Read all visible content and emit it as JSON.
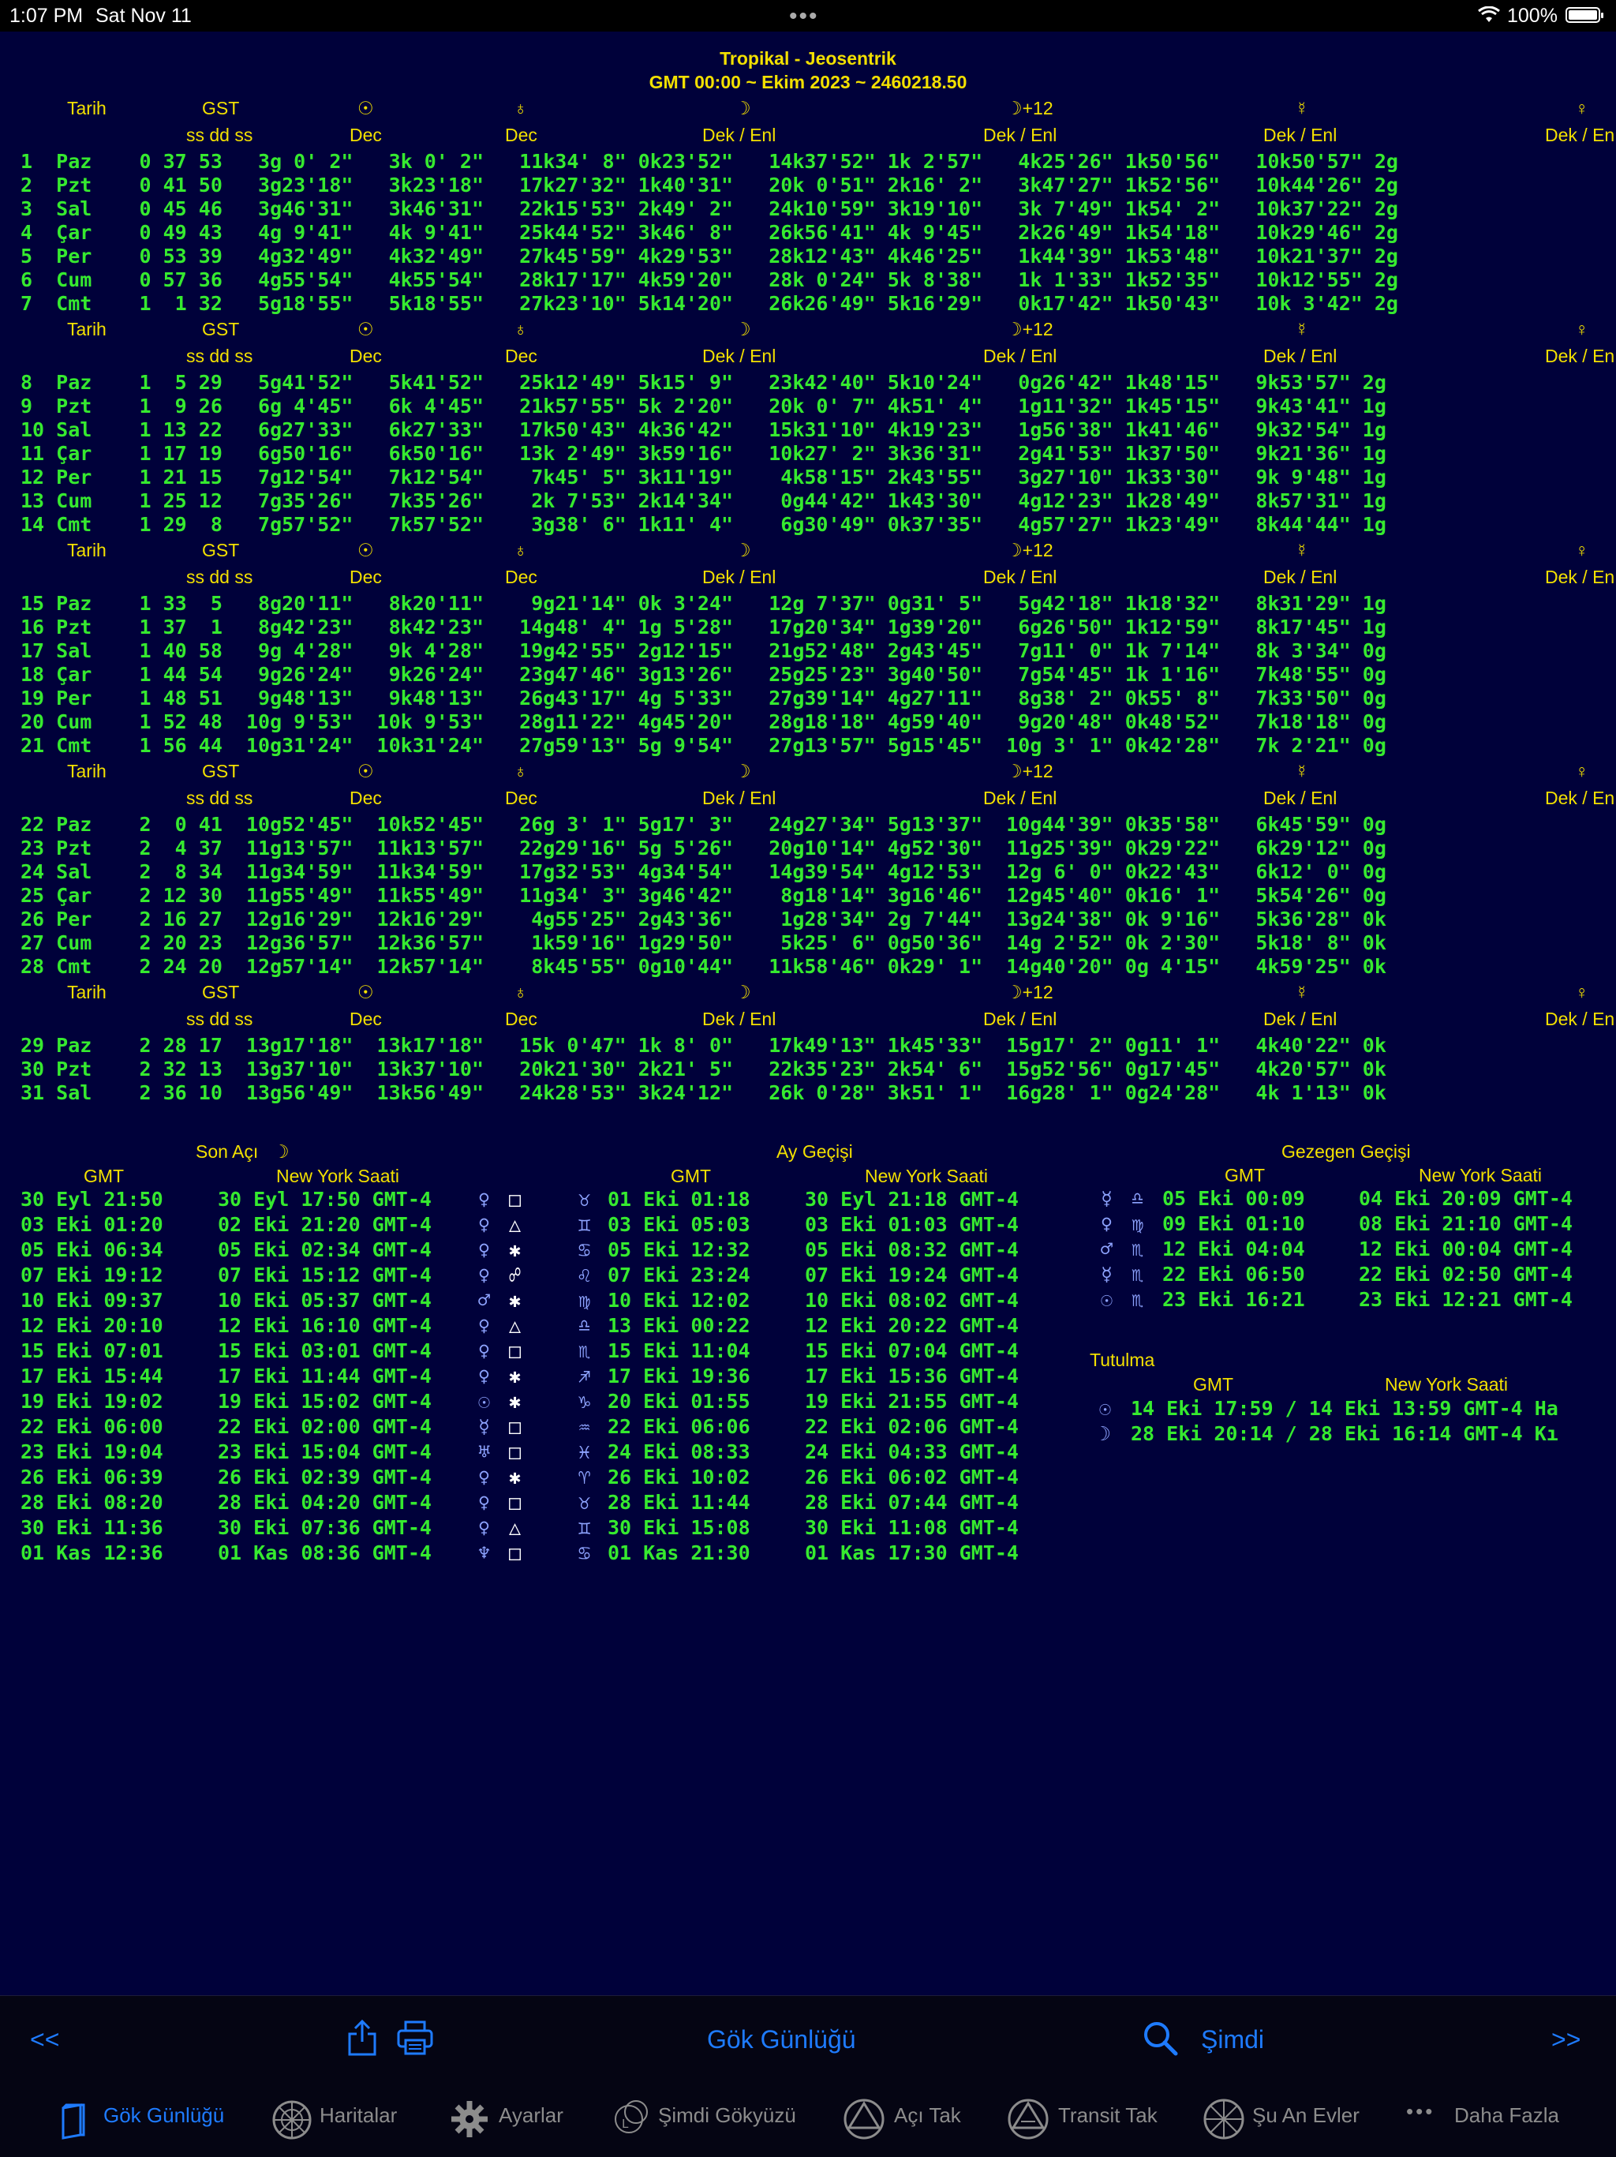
{
  "status_bar": {
    "time": "1:07 PM",
    "date": "Sat Nov 11",
    "battery": "100%"
  },
  "header": {
    "title": "Tropikal - Jeosentrik",
    "subtitle": "GMT 00:00 ~ Ekim 2023 ~ 2460218.50"
  },
  "ephemeris": {
    "col_headers": {
      "tarih": "Tarih",
      "gst": "GST",
      "sun": "☉",
      "earth": "♁",
      "moon": "☽",
      "moon12": "☽+12",
      "mercury": "☿",
      "venus": "♀"
    },
    "sub_headers": {
      "gst": "ss dd ss",
      "sun": "Dec",
      "earth": "Dec",
      "moon": "Dek / Enl",
      "moon12": "Dek / Enl",
      "mercury": "Dek / Enl",
      "venus": "Dek / En"
    },
    "rows": [
      "1  Paz    0 37 53   3g 0' 2\"   3k 0' 2\"   11k34' 8\" 0k23'52\"   14k37'52\" 1k 2'57\"   4k25'26\" 1k50'56\"   10k50'57\" 2g",
      "2  Pzt    0 41 50   3g23'18\"   3k23'18\"   17k27'32\" 1k40'31\"   20k 0'51\" 2k16' 2\"   3k47'27\" 1k52'56\"   10k44'26\" 2g",
      "3  Sal    0 45 46   3g46'31\"   3k46'31\"   22k15'53\" 2k49' 2\"   24k10'59\" 3k19'10\"   3k 7'49\" 1k54' 2\"   10k37'22\" 2g",
      "4  Çar    0 49 43   4g 9'41\"   4k 9'41\"   25k44'52\" 3k46' 8\"   26k56'41\" 4k 9'45\"   2k26'49\" 1k54'18\"   10k29'46\" 2g",
      "5  Per    0 53 39   4g32'49\"   4k32'49\"   27k45'59\" 4k29'53\"   28k12'43\" 4k46'25\"   1k44'39\" 1k53'48\"   10k21'37\" 2g",
      "6  Cum    0 57 36   4g55'54\"   4k55'54\"   28k17'17\" 4k59'20\"   28k 0'24\" 5k 8'38\"   1k 1'33\" 1k52'35\"   10k12'55\" 2g",
      "7  Cmt    1  1 32   5g18'55\"   5k18'55\"   27k23'10\" 5k14'20\"   26k26'49\" 5k16'29\"   0k17'42\" 1k50'43\"   10k 3'42\" 2g",
      "8  Paz    1  5 29   5g41'52\"   5k41'52\"   25k12'49\" 5k15' 9\"   23k42'40\" 5k10'24\"   0g26'42\" 1k48'15\"   9k53'57\" 2g",
      "9  Pzt    1  9 26   6g 4'45\"   6k 4'45\"   21k57'55\" 5k 2'20\"   20k 0' 7\" 4k51' 4\"   1g11'32\" 1k45'15\"   9k43'41\" 1g",
      "10 Sal    1 13 22   6g27'33\"   6k27'33\"   17k50'43\" 4k36'42\"   15k31'10\" 4k19'23\"   1g56'38\" 1k41'46\"   9k32'54\" 1g",
      "11 Çar    1 17 19   6g50'16\"   6k50'16\"   13k 2'49\" 3k59'16\"   10k27' 2\" 3k36'31\"   2g41'53\" 1k37'50\"   9k21'36\" 1g",
      "12 Per    1 21 15   7g12'54\"   7k12'54\"    7k45' 5\" 3k11'19\"    4k58'15\" 2k43'55\"   3g27'10\" 1k33'30\"   9k 9'48\" 1g",
      "13 Cum    1 25 12   7g35'26\"   7k35'26\"    2k 7'53\" 2k14'34\"    0g44'42\" 1k43'30\"   4g12'23\" 1k28'49\"   8k57'31\" 1g",
      "14 Cmt    1 29  8   7g57'52\"   7k57'52\"    3g38' 6\" 1k11' 4\"    6g30'49\" 0k37'35\"   4g57'27\" 1k23'49\"   8k44'44\" 1g",
      "15 Paz    1 33  5   8g20'11\"   8k20'11\"    9g21'14\" 0k 3'24\"   12g 7'37\" 0g31' 5\"   5g42'18\" 1k18'32\"   8k31'29\" 1g",
      "16 Pzt    1 37  1   8g42'23\"   8k42'23\"   14g48' 4\" 1g 5'28\"   17g20'34\" 1g39'20\"   6g26'50\" 1k12'59\"   8k17'45\" 1g",
      "17 Sal    1 40 58   9g 4'28\"   9k 4'28\"   19g42'55\" 2g12'15\"   21g52'48\" 2g43'45\"   7g11' 0\" 1k 7'14\"   8k 3'34\" 0g",
      "18 Çar    1 44 54   9g26'24\"   9k26'24\"   23g47'46\" 3g13'26\"   25g25'23\" 3g40'50\"   7g54'45\" 1k 1'16\"   7k48'55\" 0g",
      "19 Per    1 48 51   9g48'13\"   9k48'13\"   26g43'17\" 4g 5'33\"   27g39'14\" 4g27'11\"   8g38' 2\" 0k55' 8\"   7k33'50\" 0g",
      "20 Cum    1 52 48  10g 9'53\"  10k 9'53\"   28g11'22\" 4g45'20\"   28g18'18\" 4g59'40\"   9g20'48\" 0k48'52\"   7k18'18\" 0g",
      "21 Cmt    1 56 44  10g31'24\"  10k31'24\"   27g59'13\" 5g 9'54\"   27g13'57\" 5g15'45\"  10g 3' 1\" 0k42'28\"   7k 2'21\" 0g",
      "22 Paz    2  0 41  10g52'45\"  10k52'45\"   26g 3' 1\" 5g17' 3\"   24g27'34\" 5g13'37\"  10g44'39\" 0k35'58\"   6k45'59\" 0g",
      "23 Pzt    2  4 37  11g13'57\"  11k13'57\"   22g29'16\" 5g 5'26\"   20g10'14\" 4g52'30\"  11g25'39\" 0k29'22\"   6k29'12\" 0g",
      "24 Sal    2  8 34  11g34'59\"  11k34'59\"   17g32'53\" 4g34'54\"   14g39'54\" 4g12'53\"  12g 6' 0\" 0k22'43\"   6k12' 0\" 0g",
      "25 Çar    2 12 30  11g55'49\"  11k55'49\"   11g34' 3\" 3g46'42\"    8g18'14\" 3g16'46\"  12g45'40\" 0k16' 1\"   5k54'26\" 0g",
      "26 Per    2 16 27  12g16'29\"  12k16'29\"    4g55'25\" 2g43'36\"    1g28'34\" 2g 7'44\"  13g24'38\" 0k 9'16\"   5k36'28\" 0k",
      "27 Cum    2 20 23  12g36'57\"  12k36'57\"    1k59'16\" 1g29'50\"    5k25' 6\" 0g50'36\"  14g 2'52\" 0k 2'30\"   5k18' 8\" 0k",
      "28 Cmt    2 24 20  12g57'14\"  12k57'14\"    8k45'55\" 0g10'44\"   11k58'46\" 0k29' 1\"  14g40'20\" 0g 4'15\"   4k59'25\" 0k",
      "29 Paz    2 28 17  13g17'18\"  13k17'18\"   15k 0'47\" 1k 8' 0\"   17k49'13\" 1k45'33\"  15g17' 2\" 0g11' 1\"   4k40'22\" 0k",
      "30 Pzt    2 32 13  13g37'10\"  13k37'10\"   20k21'30\" 2k21' 5\"   22k35'23\" 2k54' 6\"  15g52'56\" 0g17'45\"   4k20'57\" 0k",
      "31 Sal    2 36 10  13g56'49\"  13k56'49\"   24k28'53\" 3k24'12\"   26k 0'28\" 3k51' 1\"  16g28' 1\" 0g24'28\"   4k 1'13\" 0k"
    ]
  },
  "son_aci": {
    "title": "Son Açı",
    "title_symbol": "☽",
    "gmt_label": "GMT",
    "ny_label": "New York Saati",
    "rows": [
      {
        "gmt": "30 Eyl 21:50",
        "ny": "30 Eyl 17:50 GMT-4",
        "planet": "♀",
        "aspect": "□"
      },
      {
        "gmt": "03 Eki 01:20",
        "ny": "02 Eki 21:20 GMT-4",
        "planet": "♀",
        "aspect": "△"
      },
      {
        "gmt": "05 Eki 06:34",
        "ny": "05 Eki 02:34 GMT-4",
        "planet": "♀",
        "aspect": "✱"
      },
      {
        "gmt": "07 Eki 19:12",
        "ny": "07 Eki 15:12 GMT-4",
        "planet": "♀",
        "aspect": "☍"
      },
      {
        "gmt": "10 Eki 09:37",
        "ny": "10 Eki 05:37 GMT-4",
        "planet": "♂",
        "aspect": "✱"
      },
      {
        "gmt": "12 Eki 20:10",
        "ny": "12 Eki 16:10 GMT-4",
        "planet": "♀",
        "aspect": "△"
      },
      {
        "gmt": "15 Eki 07:01",
        "ny": "15 Eki 03:01 GMT-4",
        "planet": "♀",
        "aspect": "□"
      },
      {
        "gmt": "17 Eki 15:44",
        "ny": "17 Eki 11:44 GMT-4",
        "planet": "♀",
        "aspect": "✱"
      },
      {
        "gmt": "19 Eki 19:02",
        "ny": "19 Eki 15:02 GMT-4",
        "planet": "☉",
        "aspect": "✱"
      },
      {
        "gmt": "22 Eki 06:00",
        "ny": "22 Eki 02:00 GMT-4",
        "planet": "☿",
        "aspect": "□"
      },
      {
        "gmt": "23 Eki 19:04",
        "ny": "23 Eki 15:04 GMT-4",
        "planet": "♅",
        "aspect": "□"
      },
      {
        "gmt": "26 Eki 06:39",
        "ny": "26 Eki 02:39 GMT-4",
        "planet": "♀",
        "aspect": "✱"
      },
      {
        "gmt": "28 Eki 08:20",
        "ny": "28 Eki 04:20 GMT-4",
        "planet": "♀",
        "aspect": "□"
      },
      {
        "gmt": "30 Eki 11:36",
        "ny": "30 Eki 07:36 GMT-4",
        "planet": "♀",
        "aspect": "△"
      },
      {
        "gmt": "01 Kas 12:36",
        "ny": "01 Kas 08:36 GMT-4",
        "planet": "♆",
        "aspect": "□"
      }
    ]
  },
  "ay_gecisi": {
    "title": "Ay Geçişi",
    "gmt_label": "GMT",
    "ny_label": "New York Saati",
    "rows": [
      {
        "sign": "♉",
        "gmt": "01 Eki 01:18",
        "ny": "30 Eyl 21:18 GMT-4"
      },
      {
        "sign": "♊",
        "gmt": "03 Eki 05:03",
        "ny": "03 Eki 01:03 GMT-4"
      },
      {
        "sign": "♋",
        "gmt": "05 Eki 12:32",
        "ny": "05 Eki 08:32 GMT-4"
      },
      {
        "sign": "♌",
        "gmt": "07 Eki 23:24",
        "ny": "07 Eki 19:24 GMT-4"
      },
      {
        "sign": "♍",
        "gmt": "10 Eki 12:02",
        "ny": "10 Eki 08:02 GMT-4"
      },
      {
        "sign": "♎",
        "gmt": "13 Eki 00:22",
        "ny": "12 Eki 20:22 GMT-4"
      },
      {
        "sign": "♏",
        "gmt": "15 Eki 11:04",
        "ny": "15 Eki 07:04 GMT-4"
      },
      {
        "sign": "♐",
        "gmt": "17 Eki 19:36",
        "ny": "17 Eki 15:36 GMT-4"
      },
      {
        "sign": "♑",
        "gmt": "20 Eki 01:55",
        "ny": "19 Eki 21:55 GMT-4"
      },
      {
        "sign": "♒",
        "gmt": "22 Eki 06:06",
        "ny": "22 Eki 02:06 GMT-4"
      },
      {
        "sign": "♓",
        "gmt": "24 Eki 08:33",
        "ny": "24 Eki 04:33 GMT-4"
      },
      {
        "sign": "♈",
        "gmt": "26 Eki 10:02",
        "ny": "26 Eki 06:02 GMT-4"
      },
      {
        "sign": "♉",
        "gmt": "28 Eki 11:44",
        "ny": "28 Eki 07:44 GMT-4"
      },
      {
        "sign": "♊",
        "gmt": "30 Eki 15:08",
        "ny": "30 Eki 11:08 GMT-4"
      },
      {
        "sign": "♋",
        "gmt": "01 Kas 21:30",
        "ny": "01 Kas 17:30 GMT-4"
      }
    ]
  },
  "gezegen_gecisi": {
    "title": "Gezegen Geçişi",
    "gmt_label": "GMT",
    "ny_label": "New York Saati",
    "rows": [
      {
        "planet": "☿",
        "sign": "♎",
        "gmt": "05 Eki 00:09",
        "ny": "04 Eki 20:09 GMT-4"
      },
      {
        "planet": "♀",
        "sign": "♍",
        "gmt": "09 Eki 01:10",
        "ny": "08 Eki 21:10 GMT-4"
      },
      {
        "planet": "♂",
        "sign": "♏",
        "gmt": "12 Eki 04:04",
        "ny": "12 Eki 00:04 GMT-4"
      },
      {
        "planet": "☿",
        "sign": "♏",
        "gmt": "22 Eki 06:50",
        "ny": "22 Eki 02:50 GMT-4"
      },
      {
        "planet": "☉",
        "sign": "♏",
        "gmt": "23 Eki 16:21",
        "ny": "23 Eki 12:21 GMT-4"
      }
    ]
  },
  "tutulma": {
    "title": "Tutulma",
    "gmt_label": "GMT",
    "ny_label": "New York Saati",
    "rows": [
      {
        "symbol": "☉",
        "text": "14 Eki 17:59 / 14 Eki 13:59 GMT-4 Ha"
      },
      {
        "symbol": "☽",
        "text": "28 Eki 20:14 / 28 Eki 16:14 GMT-4 Kı"
      }
    ]
  },
  "toolbar": {
    "prev": "<<",
    "next": ">>",
    "title": "Gök Günlüğü",
    "now": "Şimdi"
  },
  "tabs": [
    {
      "label": "Gök Günlüğü",
      "active": true
    },
    {
      "label": "Haritalar"
    },
    {
      "label": "Ayarlar"
    },
    {
      "label": "Şimdi Gökyüzü"
    },
    {
      "label": "Açı Tak"
    },
    {
      "label": "Transit Tak"
    },
    {
      "label": "Şu An Evler"
    },
    {
      "label": "Daha Fazla"
    }
  ],
  "colors": {
    "background": "#00013a",
    "text_green": "#36ea2f",
    "header_yellow": "#f2e000",
    "accent_blue": "#1e7bff",
    "glyph_blue": "#8ea4ff"
  }
}
